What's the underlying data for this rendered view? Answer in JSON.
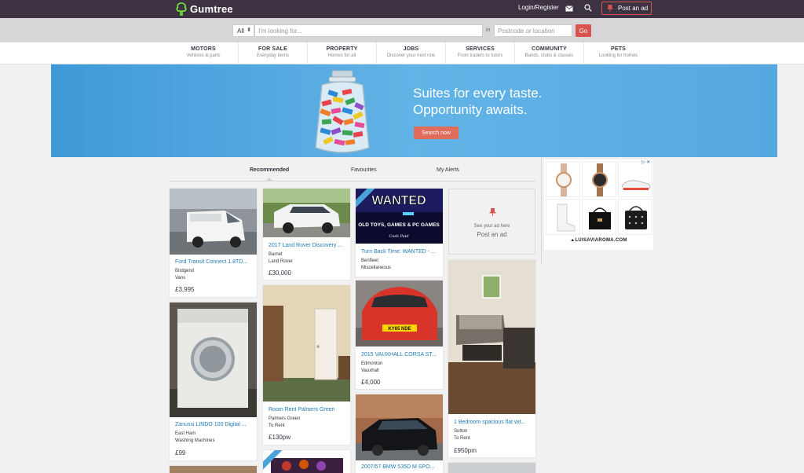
{
  "header": {
    "brand": "Gumtree",
    "login_label": "Login/Register",
    "post_ad_label": "Post an ad"
  },
  "search": {
    "category_value": "All",
    "query_placeholder": "I'm looking for...",
    "in_label": "in",
    "location_placeholder": "Postcode or location",
    "go_label": "Go"
  },
  "categories": [
    {
      "title": "MOTORS",
      "sub": "Vehicles & parts"
    },
    {
      "title": "FOR SALE",
      "sub": "Everyday items"
    },
    {
      "title": "PROPERTY",
      "sub": "Homes for all"
    },
    {
      "title": "JOBS",
      "sub": "Discover your next role"
    },
    {
      "title": "SERVICES",
      "sub": "From traders to tutors"
    },
    {
      "title": "COMMUNITY",
      "sub": "Bands, clubs & classes"
    },
    {
      "title": "PETS",
      "sub": "Looking for homes"
    }
  ],
  "banner": {
    "line1": "Suites for every taste.",
    "line2": "Opportunity awaits.",
    "cta": "Search now"
  },
  "tabs": [
    {
      "label": "Recommended",
      "active": true
    },
    {
      "label": "Favourites",
      "active": false
    },
    {
      "label": "My Alerts",
      "active": false
    }
  ],
  "listings": [
    {
      "title": "Ford Transit Connect 1.8TD...",
      "location": "Bridgend",
      "category": "Vans",
      "price": "£3,995"
    },
    {
      "title": "Zanussi LINDO 100 Digital ...",
      "location": "East Ham",
      "category": "Washing Machines",
      "price": "£99"
    },
    {
      "title": "2017 Land Rover Discovery ...",
      "location": "Barnet",
      "category": "Land Rover",
      "price": "£30,000"
    },
    {
      "title": "Room Rent Palmers Green",
      "location": "Palmers Green",
      "category": "To Rent",
      "price": "£130pw"
    },
    {
      "title": "Turn Back Time: WANTED - ...",
      "location": "Benfleet",
      "category": "Miscellaneous",
      "price": ""
    },
    {
      "title": "2015 VAUXHALL CORSA ST...",
      "location": "Edmonton",
      "category": "Vauxhall",
      "price": "£4,000"
    },
    {
      "title": "2007/57 BMW 535D M SPO...",
      "location": "",
      "category": "",
      "price": ""
    },
    {
      "title": "1 Bedroom spacious flat wit...",
      "location": "Sutton",
      "category": "To Rent",
      "price": "£950pm"
    }
  ],
  "wanted_image": {
    "headline": "WANTED",
    "subline": "OLD TOYS, GAMES & PC GAMES",
    "signature": "Cash Paid"
  },
  "plate_text": "KY65 NDE",
  "your_ad": {
    "line1": "See your ad here",
    "line2": "Post an ad"
  },
  "side_ad": {
    "brand": "▲LUISAVIAROMA.COM",
    "flag": "▷ ✕"
  },
  "colors": {
    "header_bg": "#3c3241",
    "accent_red": "#d9534f",
    "link_blue": "#1e7bb8",
    "brand_green": "#72ef36"
  }
}
